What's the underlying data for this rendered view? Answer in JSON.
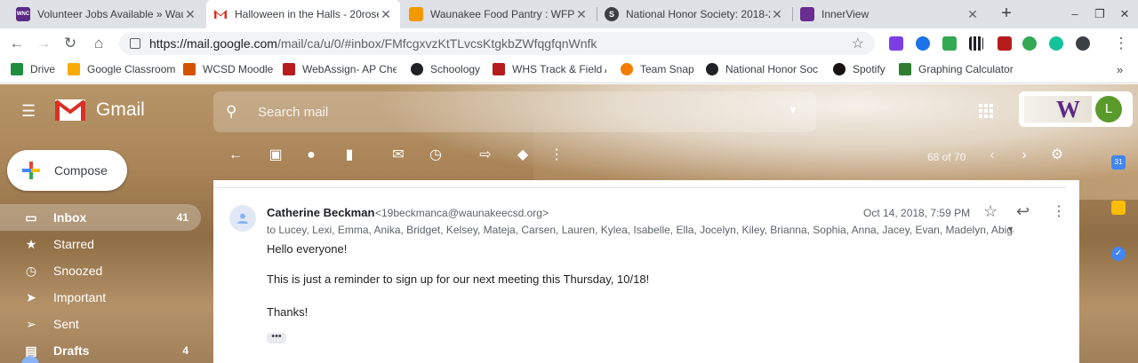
{
  "tabs": [
    {
      "title": "Volunteer Jobs Available » Wau",
      "fav_text": "WNC",
      "fav_color": "#5b2a86"
    },
    {
      "title": "Halloween in the Halls - 20rose",
      "fav_text": "M",
      "fav_color": "#ffffff"
    },
    {
      "title": "Waunakee Food Pantry : WFP V",
      "fav_text": "",
      "fav_color": "#f29900"
    },
    {
      "title": "National Honor Society: 2018-2",
      "fav_text": "S",
      "fav_color": "#3c4043"
    },
    {
      "title": "InnerView",
      "fav_text": "",
      "fav_color": "#6a2c91"
    }
  ],
  "window_controls": {
    "new_tab": "+",
    "minimize": "–",
    "restore": "❐",
    "close": "✕"
  },
  "address_bar": {
    "host": "https://mail.google.com",
    "path": "/mail/ca/u/0/#inbox/FMfcgxvzKtTLvcsKtgkbZWfqgfqnWnfk"
  },
  "bookmarks": [
    {
      "label": "Drive",
      "color": "#1e8e3e"
    },
    {
      "label": "Google Classroom",
      "color": "#f9ab00"
    },
    {
      "label": "WCSD Moodle",
      "color": "#d35400"
    },
    {
      "label": "WebAssign- AP Chem",
      "color": "#b71c1c"
    },
    {
      "label": "Schoology",
      "color": "#202124"
    },
    {
      "label": "WHS Track & Field A",
      "color": "#b71c1c"
    },
    {
      "label": "Team Snap",
      "color": "#f57c00"
    },
    {
      "label": "National Honor Soci",
      "color": "#202124"
    },
    {
      "label": "Spotify",
      "color": "#191414"
    },
    {
      "label": "Graphing Calculator",
      "color": "#2e7d32"
    }
  ],
  "gmail": {
    "brand": "Gmail",
    "search_placeholder": "Search mail",
    "compose_label": "Compose",
    "account_initial": "L",
    "org_logo_letter": "W",
    "nav": [
      {
        "label": "Inbox",
        "count": "41",
        "icon": "inbox-icon"
      },
      {
        "label": "Starred",
        "count": "",
        "icon": "star-icon"
      },
      {
        "label": "Snoozed",
        "count": "",
        "icon": "clock-icon"
      },
      {
        "label": "Important",
        "count": "",
        "icon": "important-icon"
      },
      {
        "label": "Sent",
        "count": "",
        "icon": "send-icon"
      },
      {
        "label": "Drafts",
        "count": "4",
        "icon": "draft-icon"
      }
    ],
    "pager": "68 of 70"
  },
  "message": {
    "sender_name": "Catherine Beckman",
    "sender_email": "<19beckmanca@waunakeecsd.org>",
    "date": "Oct 14, 2018, 7:59 PM",
    "recipients": "to Lucey, Lexi, Emma, Anika, Bridget, Kelsey, Mateja, Carsen, Lauren, Kylea, Isabelle, Ella, Jocelyn, Kiley, Brianna, Sophia, Anna, Jacey, Evan, Madelyn, Abigail, E",
    "body": [
      "Hello everyone!",
      "This is just a reminder to sign up for our next meeting this Thursday, 10/18!",
      "Thanks!"
    ],
    "ellipsis": "•••"
  }
}
